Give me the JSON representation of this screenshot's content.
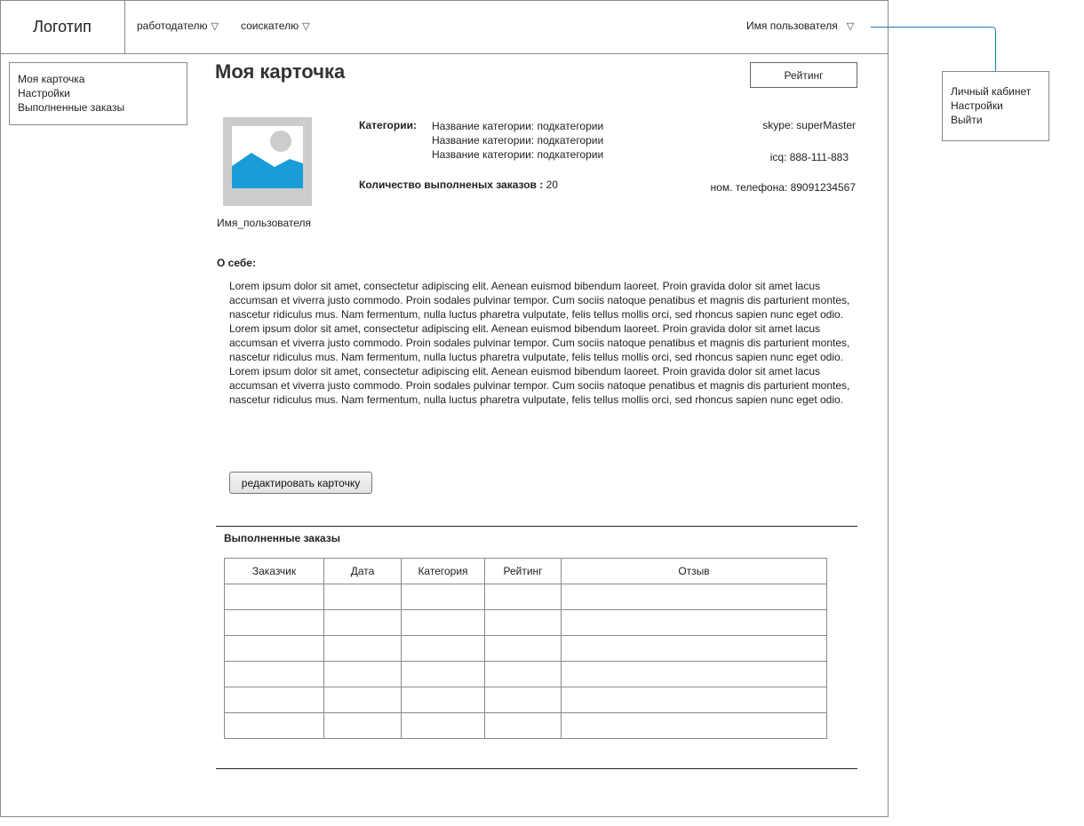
{
  "header": {
    "logo": "Логотип",
    "nav": [
      {
        "label": "работодателю"
      },
      {
        "label": "соискателю"
      }
    ],
    "user_name": "Имя пользователя",
    "dropdown_icon": "triangle-down-icon"
  },
  "user_dropdown": {
    "items": [
      {
        "label": "Личный кабинет"
      },
      {
        "label": "Настройки"
      },
      {
        "label": "Выйти"
      }
    ]
  },
  "sidebar": {
    "items": [
      {
        "label": "Моя карточка"
      },
      {
        "label": "Настройки"
      },
      {
        "label": "Выполненные заказы"
      }
    ]
  },
  "profile": {
    "title": "Моя карточка",
    "rating_button": "Рейтинг",
    "avatar_icon": "image-placeholder-icon",
    "username": "Имя_пользователя",
    "categories_label": "Категории:",
    "categories": [
      "Название категории: подкатегории",
      "Название категории: подкатегории",
      "Название категории: подкатегории"
    ],
    "orders_count_label": "Количество выполненых заказов :",
    "orders_count": "20",
    "skype": "skype: superMaster",
    "icq": "icq: 888-111-883",
    "phone": "ном. телефона: 89091234567",
    "about_label": "О себе:",
    "about_paragraphs": [
      "Lorem ipsum dolor sit amet, consectetur adipiscing elit. Aenean euismod bibendum laoreet. Proin gravida dolor sit amet lacus accumsan et viverra justo commodo. Proin sodales pulvinar tempor. Cum sociis natoque penatibus et magnis dis parturient montes, nascetur ridiculus mus. Nam fermentum, nulla luctus pharetra vulputate, felis tellus mollis orci, sed rhoncus sapien nunc eget odio.",
      "Lorem ipsum dolor sit amet, consectetur adipiscing elit. Aenean euismod bibendum laoreet. Proin gravida dolor sit amet lacus accumsan et viverra justo commodo. Proin sodales pulvinar tempor. Cum sociis natoque penatibus et magnis dis parturient montes, nascetur ridiculus mus. Nam fermentum, nulla luctus pharetra vulputate, felis tellus mollis orci, sed rhoncus sapien nunc eget odio.",
      "Lorem ipsum dolor sit amet, consectetur adipiscing elit. Aenean euismod bibendum laoreet. Proin gravida dolor sit amet lacus accumsan et viverra justo commodo. Proin sodales pulvinar tempor. Cum sociis natoque penatibus et magnis dis parturient montes, nascetur ridiculus mus. Nam fermentum, nulla luctus pharetra vulputate, felis tellus mollis orci, sed rhoncus sapien nunc eget odio."
    ],
    "edit_button": "редактировать карточку"
  },
  "orders": {
    "title": "Выполненные заказы",
    "columns": [
      "Заказчик",
      "Дата",
      "Категория",
      "Рейтинг",
      "Отзыв"
    ],
    "rows": [
      [
        "",
        "",
        "",
        "",
        ""
      ],
      [
        "",
        "",
        "",
        "",
        ""
      ],
      [
        "",
        "",
        "",
        "",
        ""
      ],
      [
        "",
        "",
        "",
        "",
        ""
      ],
      [
        "",
        "",
        "",
        "",
        ""
      ],
      [
        "",
        "",
        "",
        "",
        ""
      ]
    ]
  },
  "colors": {
    "border": "#8a8a8a",
    "avatar_bg": "#cccccc",
    "avatar_accent": "#1a9cd8",
    "connector": "#1a7fb8"
  }
}
